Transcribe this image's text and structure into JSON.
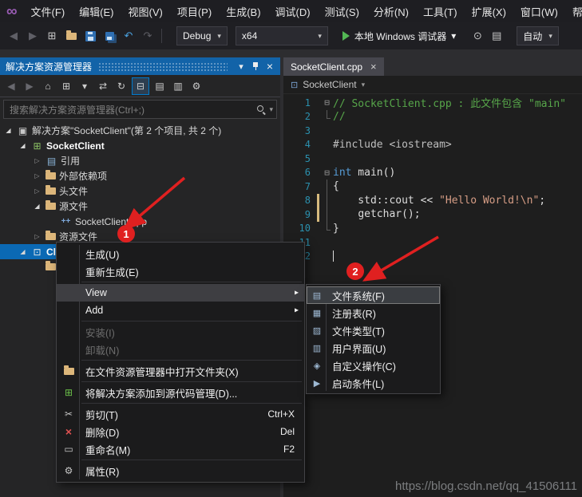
{
  "colors": {
    "titlebar_blue": "#1263a8",
    "selection_blue": "#0b69b4",
    "annotation_red": "#e02020",
    "editor_bg": "#1e1e1e",
    "panel_bg": "#252526",
    "menu_bg": "#1b1b1c"
  },
  "glyphs": {
    "chevron_down": "▾",
    "close": "×",
    "project": "⊡",
    "submenu_arrow": "▸",
    "twisty_expanded": "◢",
    "twisty_collapsed": "▷",
    "fold_box": "⊟",
    "vs_logo": "∞"
  },
  "menubar": {
    "items": [
      "文件(F)",
      "编辑(E)",
      "视图(V)",
      "项目(P)",
      "生成(B)",
      "调试(D)",
      "测试(S)",
      "分析(N)",
      "工具(T)",
      "扩展(X)",
      "窗口(W)",
      "帮助"
    ]
  },
  "toolbar": {
    "configuration": "Debug",
    "platform": "x64",
    "debugger_label": "本地 Windows 调试器",
    "auto_label": "自动",
    "left_icons": [
      {
        "name": "nav-back-icon",
        "glyph": "◀",
        "dim": true
      },
      {
        "name": "nav-forward-icon",
        "glyph": "▶",
        "dim": true
      },
      {
        "name": "new-file-icon",
        "glyph": "⊞"
      },
      {
        "name": "open-file-icon",
        "cls": "ic-folder"
      },
      {
        "name": "save-icon",
        "cls": "ic-save"
      },
      {
        "name": "save-all-icon",
        "cls": "ic-saveall"
      },
      {
        "name": "undo-icon",
        "glyph": "↶",
        "blue": true
      },
      {
        "name": "redo-icon",
        "glyph": "↷",
        "dim": true
      }
    ],
    "right_icons": [
      {
        "name": "break-all-icon",
        "glyph": "⊙"
      },
      {
        "name": "show-output-icon",
        "glyph": "▤"
      }
    ]
  },
  "solution_explorer": {
    "title": "解决方案资源管理器",
    "search_placeholder": "搜索解决方案资源管理器(Ctrl+;)",
    "toolbar_icons": [
      {
        "name": "back-icon",
        "glyph": "◀",
        "dim": true
      },
      {
        "name": "forward-icon",
        "glyph": "▶",
        "dim": true
      },
      {
        "name": "home-icon",
        "glyph": "⌂"
      },
      {
        "name": "switch-views-icon",
        "glyph": "⊞"
      },
      {
        "name": "filter-icon",
        "glyph": "▾"
      },
      {
        "name": "sync-active-document-icon",
        "glyph": "⇄"
      },
      {
        "name": "refresh-icon",
        "glyph": "↻"
      },
      {
        "name": "collapse-all-icon",
        "glyph": "⊟",
        "pressed": true
      },
      {
        "name": "show-all-files-icon",
        "glyph": "▤"
      },
      {
        "name": "preview-items-icon",
        "glyph": "▥"
      },
      {
        "name": "properties-icon",
        "glyph": "⚙"
      }
    ],
    "items": [
      {
        "label": "解决方案\"SocketClient\"(第 2 个项目, 共 2 个)",
        "level": 0,
        "state": "expanded",
        "icon": "solution-icon",
        "glyph": "▣"
      },
      {
        "label": "SocketClient",
        "level": 1,
        "state": "expanded",
        "icon": "cpp-project-icon",
        "glyph": "⊞",
        "bold": true
      },
      {
        "label": "引用",
        "level": 2,
        "state": "collapsed",
        "icon": "references-icon",
        "glyph": "▤"
      },
      {
        "label": "外部依赖项",
        "level": 2,
        "state": "collapsed",
        "icon": "folder-icon"
      },
      {
        "label": "头文件",
        "level": 2,
        "state": "collapsed",
        "icon": "folder-icon"
      },
      {
        "label": "源文件",
        "level": 2,
        "state": "expanded",
        "icon": "folder-icon"
      },
      {
        "label": "SocketClient.cpp",
        "level": 3,
        "state": "leaf",
        "icon": "cpp-file-icon",
        "glyph": "++"
      },
      {
        "label": "资源文件",
        "level": 2,
        "state": "collapsed",
        "icon": "folder-icon"
      },
      {
        "label": "Cl",
        "level": 1,
        "state": "expanded",
        "icon": "setup-project-icon",
        "glyph": "⊡",
        "selected": true,
        "bold": true
      },
      {
        "label": "",
        "level": 2,
        "state": "leaf",
        "icon": "folder-icon"
      }
    ]
  },
  "context_menu": {
    "items": [
      {
        "label": "生成(U)"
      },
      {
        "label": "重新生成(E)"
      },
      {
        "sep": true
      },
      {
        "label": "View",
        "submenu": true,
        "highlight": true
      },
      {
        "label": "Add",
        "submenu": true
      },
      {
        "sep": true
      },
      {
        "label": "安装(I)",
        "disabled": true
      },
      {
        "label": "卸载(N)",
        "disabled": true
      },
      {
        "sep": true
      },
      {
        "label": "在文件资源管理器中打开文件夹(X)",
        "icon": "open-folder-icon",
        "cls": "ic-folder"
      },
      {
        "sep": true
      },
      {
        "label": "将解决方案添加到源代码管理(D)...",
        "icon": "source-control-icon",
        "glyph": "⊞"
      },
      {
        "sep": true
      },
      {
        "label": "剪切(T)",
        "shortcut": "Ctrl+X",
        "icon": "cut-icon",
        "glyph": "✂"
      },
      {
        "label": "删除(D)",
        "shortcut": "Del",
        "icon": "delete-icon",
        "glyph": "×"
      },
      {
        "label": "重命名(M)",
        "shortcut": "F2",
        "icon": "rename-icon",
        "glyph": "▭"
      },
      {
        "sep": true
      },
      {
        "label": "属性(R)",
        "icon": "properties-icon",
        "glyph": "⚙"
      }
    ]
  },
  "view_submenu": {
    "items": [
      {
        "label": "文件系统(F)",
        "icon": "file-system-icon",
        "glyph": "▤",
        "highlight": true
      },
      {
        "label": "注册表(R)",
        "icon": "registry-icon",
        "glyph": "▦"
      },
      {
        "label": "文件类型(T)",
        "icon": "file-types-icon",
        "glyph": "▨"
      },
      {
        "label": "用户界面(U)",
        "icon": "user-interface-icon",
        "glyph": "▥"
      },
      {
        "label": "自定义操作(C)",
        "icon": "custom-actions-icon",
        "glyph": "◈"
      },
      {
        "label": "启动条件(L)",
        "icon": "launch-conditions-icon",
        "glyph": "▶"
      }
    ]
  },
  "editor": {
    "tab": "SocketClient.cpp",
    "breadcrumb": "SocketClient",
    "lines": [
      {
        "n": 1,
        "fold": "box",
        "segs": [
          {
            "t": "// SocketClient.cpp : 此文件包含 \"main\"",
            "c": "comment"
          }
        ]
      },
      {
        "n": 2,
        "fold": "end",
        "segs": [
          {
            "t": "//",
            "c": "comment"
          }
        ]
      },
      {
        "n": 3,
        "segs": []
      },
      {
        "n": 4,
        "segs": [
          {
            "t": "#include ",
            "c": "dir"
          },
          {
            "t": "<iostream>",
            "c": "inc"
          }
        ]
      },
      {
        "n": 5,
        "segs": []
      },
      {
        "n": 6,
        "fold": "box",
        "segs": [
          {
            "t": "int",
            "c": "kw"
          },
          {
            "t": " main()",
            "c": "plain"
          }
        ]
      },
      {
        "n": 7,
        "fold": "line",
        "segs": [
          {
            "t": "{",
            "c": "plain"
          }
        ]
      },
      {
        "n": 8,
        "fold": "line",
        "changed": true,
        "segs": [
          {
            "t": "    std::cout << ",
            "c": "plain"
          },
          {
            "t": "\"Hello World!\\n\"",
            "c": "str"
          },
          {
            "t": ";",
            "c": "plain"
          }
        ]
      },
      {
        "n": 9,
        "fold": "line",
        "changed": true,
        "segs": [
          {
            "t": "    ",
            "c": "plain"
          },
          {
            "t": "getchar();",
            "c": "plain",
            "u": true
          }
        ]
      },
      {
        "n": 10,
        "fold": "end",
        "segs": [
          {
            "t": "}",
            "c": "plain"
          }
        ]
      },
      {
        "n": 11,
        "segs": []
      },
      {
        "n": 12,
        "caret": true,
        "segs": []
      }
    ]
  },
  "badges": {
    "one": "1",
    "two": "2"
  },
  "watermark": "https://blog.csdn.net/qq_41506111"
}
